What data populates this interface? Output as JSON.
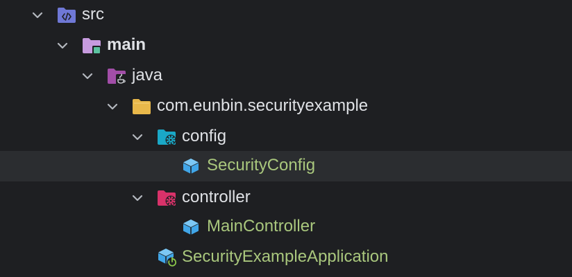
{
  "project_tree": {
    "items": [
      {
        "label": "src",
        "icon": "source-folder-icon",
        "expanded": true
      },
      {
        "label": "main",
        "icon": "module-folder-icon",
        "expanded": true
      },
      {
        "label": "java",
        "icon": "java-source-root-icon",
        "expanded": true
      },
      {
        "label": "com.eunbin.securityexample",
        "icon": "package-folder-icon",
        "expanded": true
      },
      {
        "label": "config",
        "icon": "config-folder-icon",
        "expanded": true
      },
      {
        "label": "SecurityConfig",
        "icon": "class-icon",
        "selected": true
      },
      {
        "label": "controller",
        "icon": "controller-folder-icon",
        "expanded": true
      },
      {
        "label": "MainController",
        "icon": "class-icon"
      },
      {
        "label": "SecurityExampleApplication",
        "icon": "spring-boot-application-icon"
      }
    ]
  },
  "colors": {
    "background": "#1e1f22",
    "selected_row": "#2b2d30",
    "folder_text": "#dfe1e5",
    "class_text": "#a9c77d",
    "chevron": "#b4b8bf",
    "source_folder": "#6f78d6",
    "module_folder": "#c79bdf",
    "java_folder": "#a24ea8",
    "package_folder": "#e9b84a",
    "config_folder": "#1aa8c7",
    "controller_folder": "#d9326a",
    "class_icon": "#41a6e8"
  }
}
